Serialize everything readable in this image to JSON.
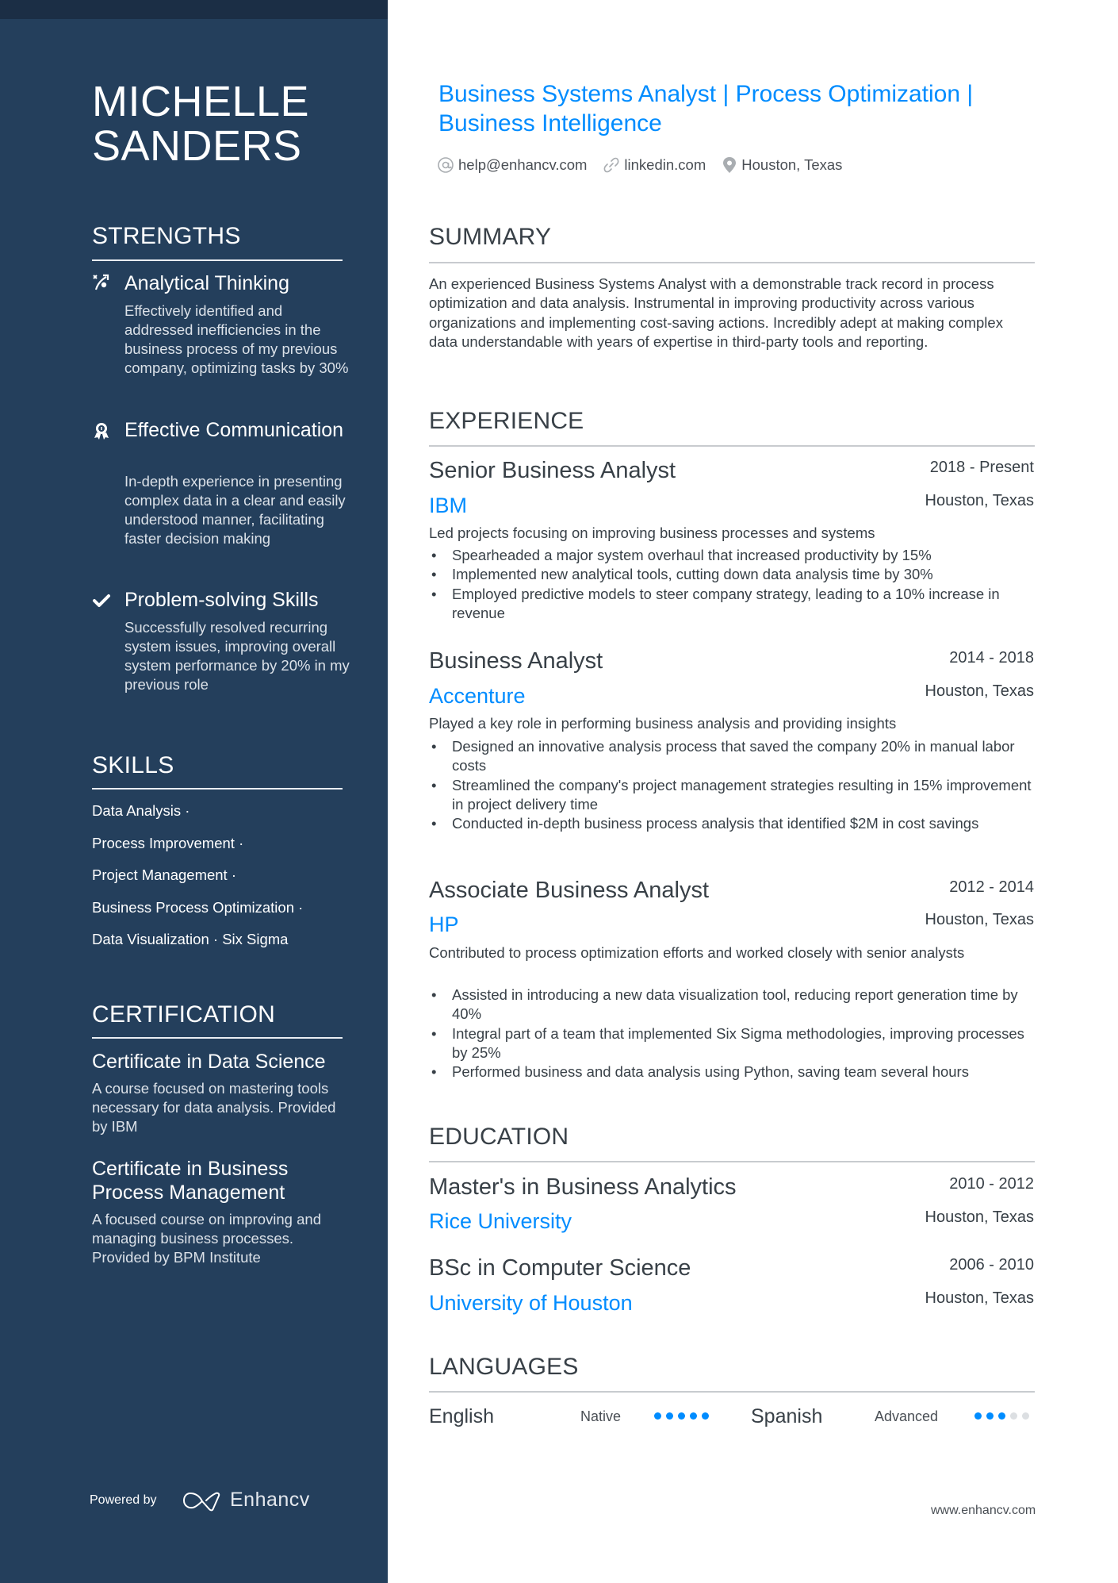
{
  "name": {
    "line1": "MICHELLE",
    "line2": "SANDERS"
  },
  "headline": "Business Systems Analyst | Process Optimization | Business Intelligence",
  "contacts": [
    {
      "icon": "at-icon",
      "text": "help@enhancv.com"
    },
    {
      "icon": "link-icon",
      "text": "linkedin.com"
    },
    {
      "icon": "map-pin-icon",
      "text": "Houston, Texas"
    }
  ],
  "sidebar": {
    "strengths": {
      "title": "STRENGTHS",
      "items": [
        {
          "icon": "strategy-icon",
          "title": "Analytical Thinking",
          "desc": "Effectively identified and addressed inefficiencies in the business process of my previous company, optimizing tasks by 30%"
        },
        {
          "icon": "award-ribbon-icon",
          "title": "Effective Communication",
          "desc": "In-depth experience in presenting complex data in a clear and easily understood manner, facilitating faster decision making"
        },
        {
          "icon": "checkmark-icon",
          "title": "Problem-solving Skills",
          "desc": "Successfully resolved recurring system issues, improving overall system performance by 20% in my previous role"
        }
      ]
    },
    "skills": {
      "title": "SKILLS",
      "lines": [
        "Data Analysis ·",
        "Process Improvement ·",
        "Project Management ·",
        "Business Process Optimization ·",
        "Data Visualization · Six Sigma"
      ]
    },
    "certification": {
      "title": "CERTIFICATION",
      "items": [
        {
          "title": "Certificate in Data Science",
          "desc": "A course focused on mastering tools necessary for data analysis. Provided by IBM"
        },
        {
          "title": "Certificate in Business Process Management",
          "desc": "A focused course on improving and managing business processes. Provided by BPM Institute"
        }
      ]
    },
    "footer": {
      "powered_by": "Powered by",
      "brand": "Enhancv"
    }
  },
  "summary": {
    "title": "SUMMARY",
    "text": "An experienced Business Systems Analyst with a demonstrable track record in process optimization and data analysis. Instrumental in improving productivity across various organizations and implementing cost-saving actions. Incredibly adept at making complex data understandable with years of expertise in third-party tools and reporting."
  },
  "experience": {
    "title": "EXPERIENCE",
    "items": [
      {
        "role": "Senior Business Analyst",
        "dates": "2018 - Present",
        "company": "IBM",
        "location": "Houston, Texas",
        "lead": "Led projects focusing on improving business processes and systems",
        "bullets": [
          "Spearheaded a major system overhaul that increased productivity by 15%",
          "Implemented new analytical tools, cutting down data analysis time by 30%",
          "Employed predictive models to steer company strategy, leading to a 10% increase in revenue"
        ]
      },
      {
        "role": "Business Analyst",
        "dates": "2014 - 2018",
        "company": "Accenture",
        "location": "Houston, Texas",
        "lead": "Played a key role in performing business analysis and providing insights",
        "bullets": [
          "Designed an innovative analysis process that saved the company 20% in manual labor costs",
          "Streamlined the company's project management strategies resulting in 15% improvement in project delivery time",
          "Conducted in-depth business process analysis that identified $2M in cost savings"
        ]
      },
      {
        "role": "Associate Business Analyst",
        "dates": "2012 - 2014",
        "company": "HP",
        "location": "Houston, Texas",
        "lead": "Contributed to process optimization efforts and worked closely with senior analysts",
        "bullets": [
          "Assisted in introducing a new data visualization tool, reducing report generation time by 40%",
          "Integral part of a team that implemented Six Sigma methodologies, improving processes by 25%",
          "Performed business and data analysis using Python, saving team several hours"
        ]
      }
    ]
  },
  "education": {
    "title": "EDUCATION",
    "items": [
      {
        "degree": "Master's in Business Analytics",
        "dates": "2010 - 2012",
        "school": "Rice University",
        "location": "Houston, Texas"
      },
      {
        "degree": "BSc in Computer Science",
        "dates": "2006 - 2010",
        "school": "University of Houston",
        "location": "Houston, Texas"
      }
    ]
  },
  "languages": {
    "title": "LANGUAGES",
    "items": [
      {
        "name": "English",
        "level": "Native",
        "rating": 5,
        "max": 5
      },
      {
        "name": "Spanish",
        "level": "Advanced",
        "rating": 3,
        "max": 5
      }
    ]
  },
  "footer_url": "www.enhancv.com",
  "colors": {
    "accent": "#008CFF",
    "sidebar": "#243F5C",
    "topbar": "#1B2E45"
  }
}
